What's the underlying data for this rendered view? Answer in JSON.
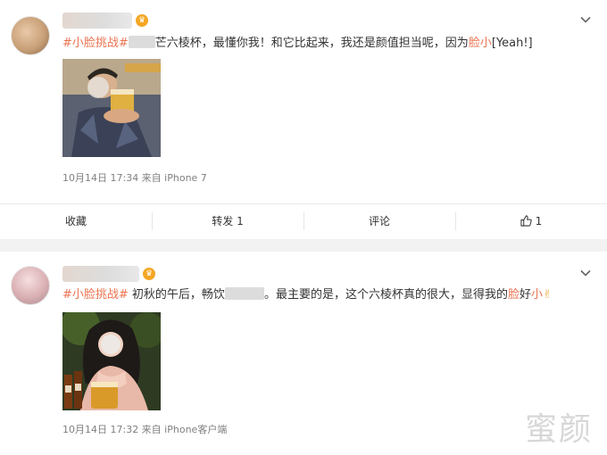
{
  "posts": [
    {
      "tag": "#小脸挑战#",
      "text_after_blur": "芒六棱杯，最懂你我！和它比起来，我还是颜值担当呢，因为",
      "hl1": "脸",
      "hl2": "小",
      "tail": "[Yeah!]",
      "meta": "10月14日 17:34  来自 iPhone 7"
    },
    {
      "tag": "#小脸挑战#",
      "text_a": " 初秋的午后，畅饮",
      "text_b": "。最主要的是，这个六棱杯真的很大，显得我的",
      "hl1": "脸",
      "mid": "好",
      "hl2": "小",
      "emoji": "✌",
      "meta": "10月14日 17:32  来自 iPhone客户端"
    }
  ],
  "actions": {
    "favorite": "收藏",
    "repost": "转发 1",
    "comment": "评论",
    "like": "1"
  },
  "watermark": "蜜颜",
  "colors": {
    "accent": "#eb7350",
    "meta": "#808080",
    "background": "#f2f2f2"
  }
}
